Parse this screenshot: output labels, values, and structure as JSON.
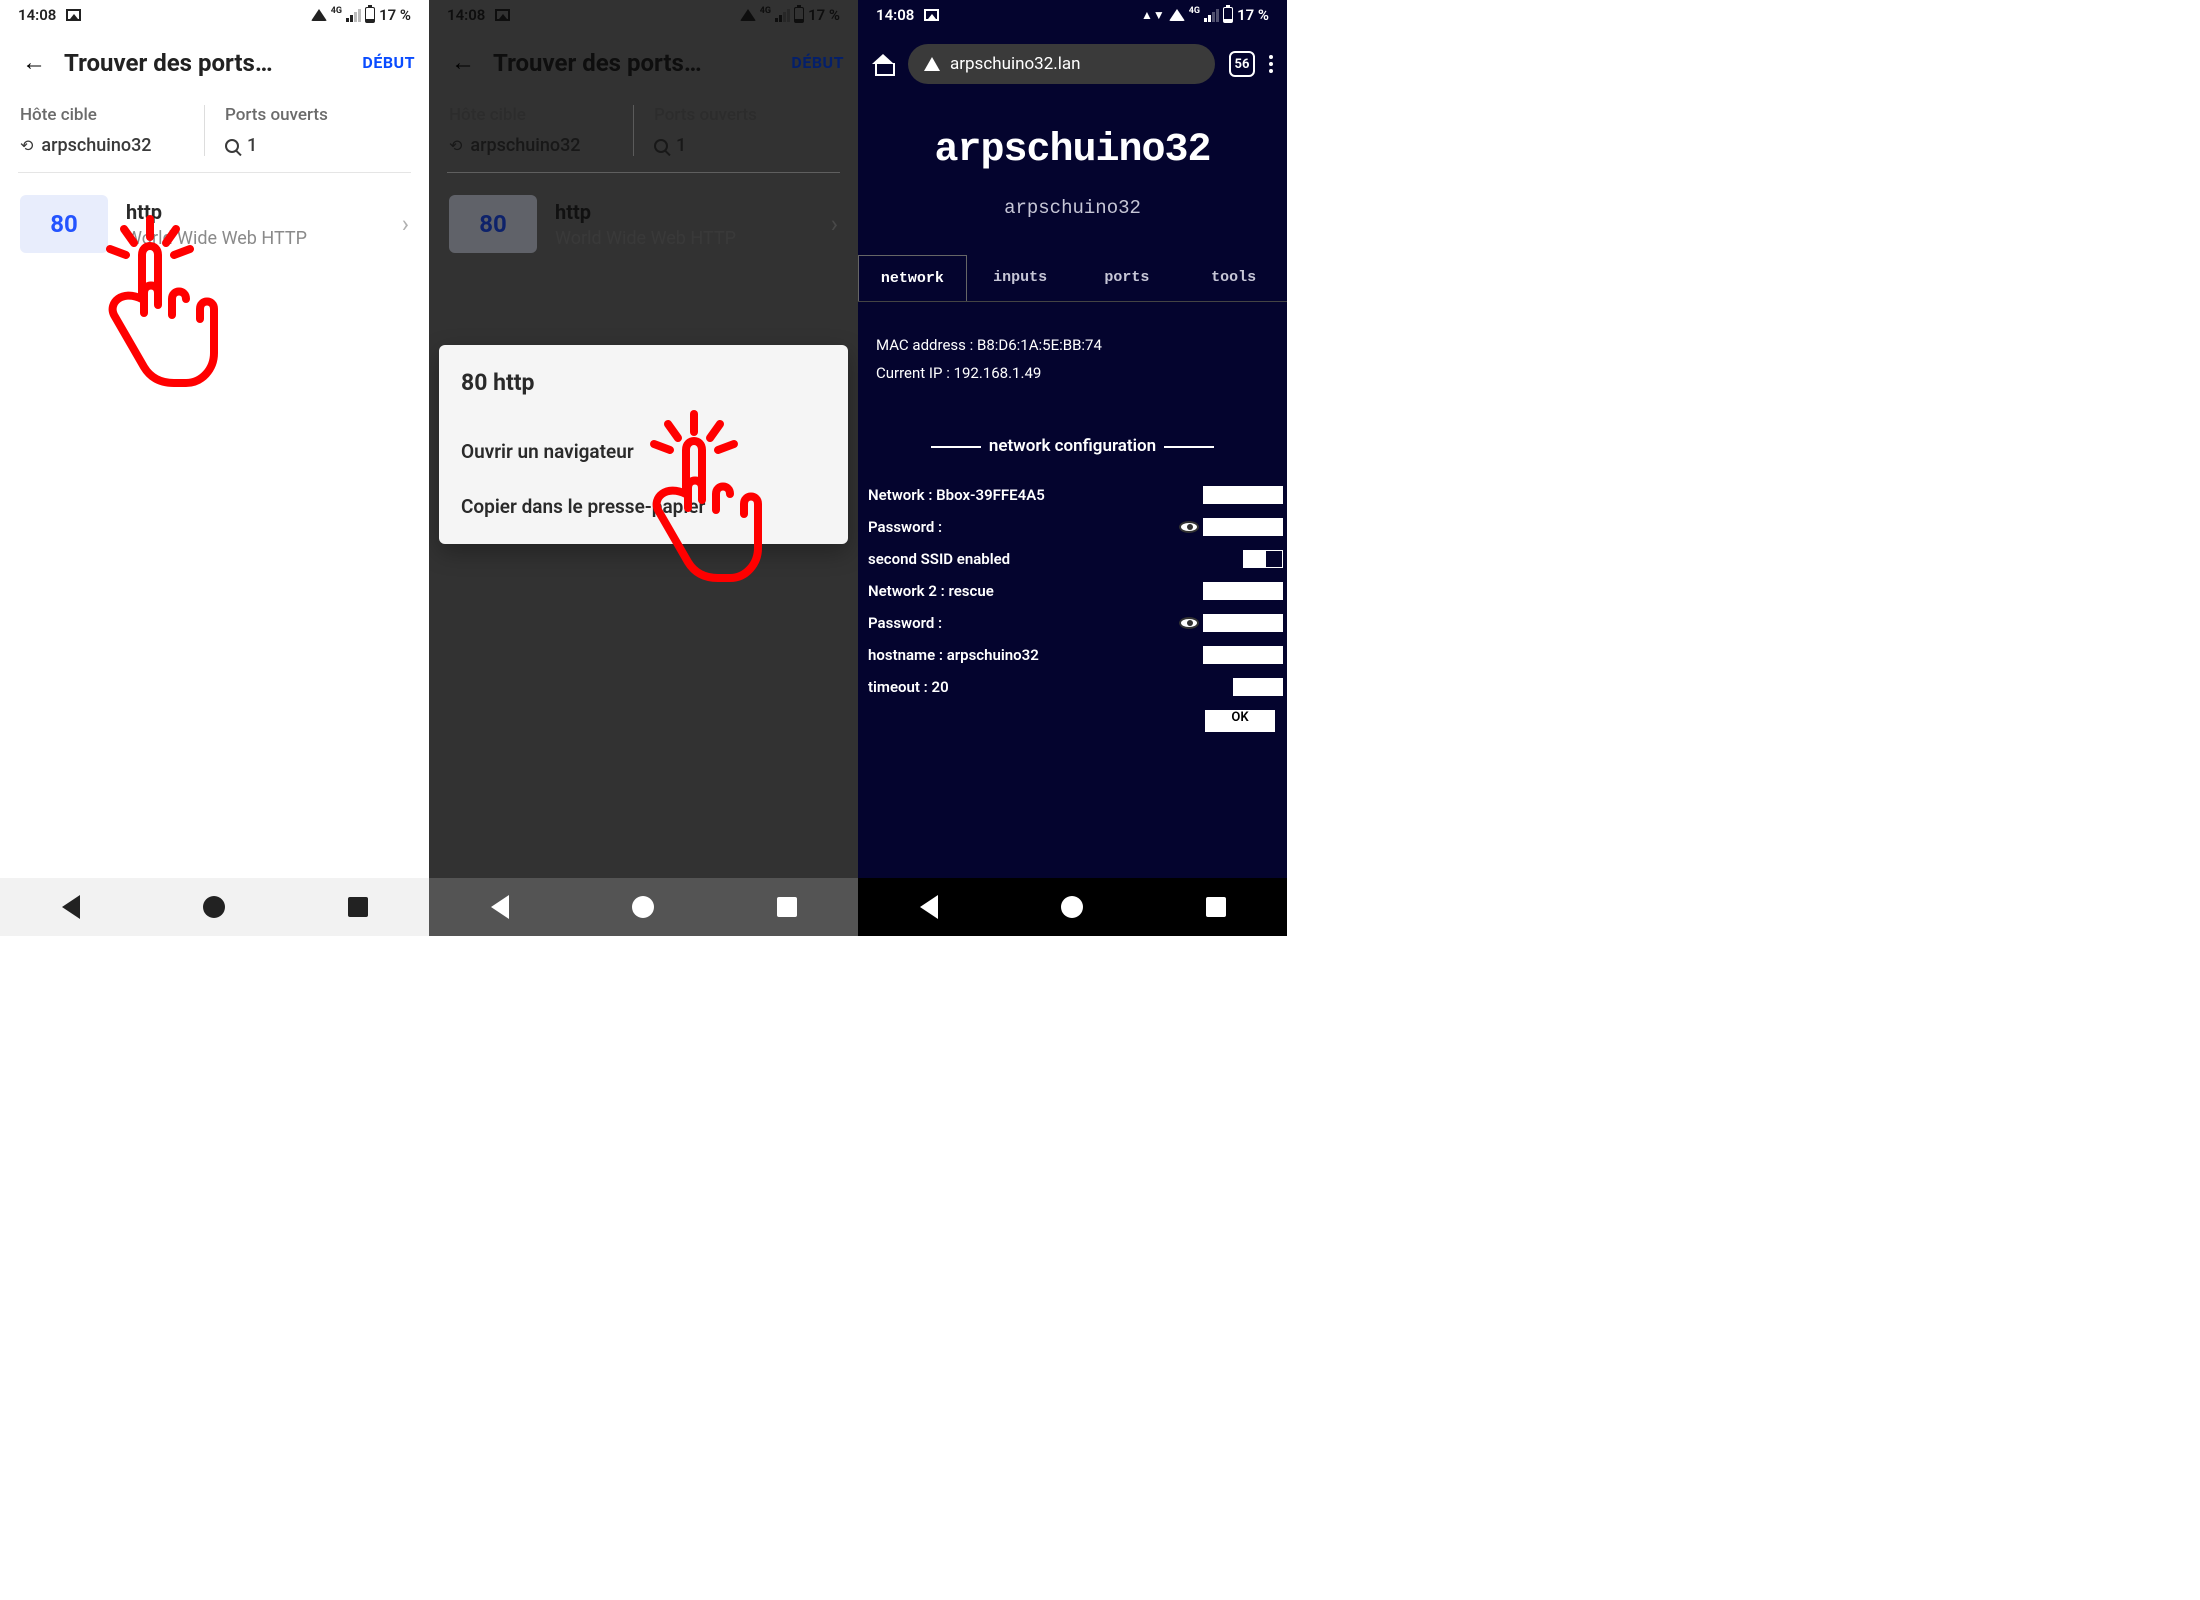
{
  "status": {
    "time": "14:08",
    "net": "4G",
    "battery": "17 %"
  },
  "scanner": {
    "title": "Trouver des ports…",
    "start": "DÉBUT",
    "host_label": "Hôte cible",
    "host_value": "arpschuino32",
    "open_label": "Ports ouverts",
    "open_count": "1",
    "port_num": "80",
    "port_name": "http",
    "port_desc": "World Wide Web HTTP"
  },
  "dialog": {
    "title": "80 http",
    "opt_open": "Ouvrir un navigateur",
    "opt_copy": "Copier dans le presse-papier"
  },
  "browser": {
    "url": "arpschuino32.lan",
    "tab_count": "56"
  },
  "page": {
    "title": "arpschuino32",
    "subtitle": "arpschuino32",
    "tabs": [
      "network",
      "inputs",
      "ports",
      "tools"
    ],
    "mac_label": "MAC address :",
    "mac": "B8:D6:1A:5E:BB:74",
    "ip_label": "Current IP :",
    "ip": "192.168.1.49",
    "section": "network configuration",
    "network_label": "Network :",
    "network": "Bbox-39FFE4A5",
    "password_label": "Password :",
    "ssid2_label": "second SSID enabled",
    "network2_label": "Network 2 :",
    "network2": "rescue",
    "hostname_label": "hostname :",
    "hostname": "arpschuino32",
    "timeout_label": "timeout :",
    "timeout": "20",
    "ok": "OK"
  }
}
